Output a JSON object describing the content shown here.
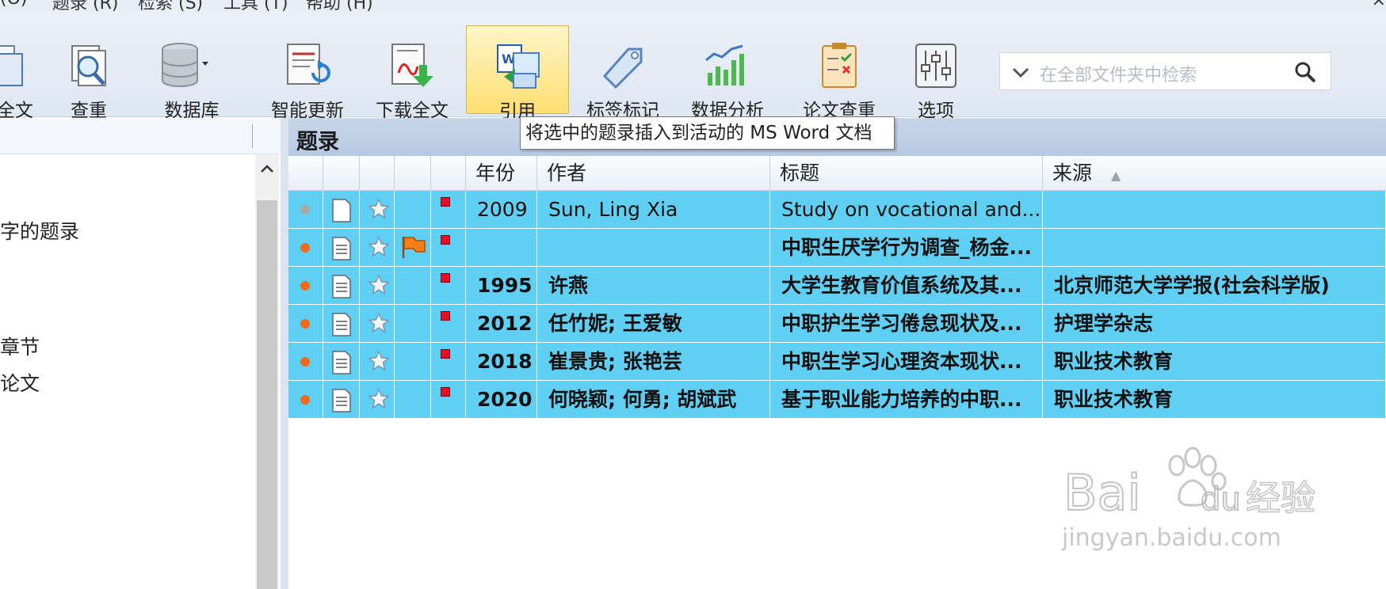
{
  "menubar": {
    "items": [
      "(O)",
      "题录 (R)",
      "检索 (S)",
      "工具 (T)",
      "帮助 (H)"
    ],
    "close_glyph": "×"
  },
  "toolbar": {
    "buttons": [
      {
        "label": "全文",
        "icon": "fulltext-icon"
      },
      {
        "label": "查重",
        "icon": "duplicate-check-icon"
      },
      {
        "label": "数据库",
        "icon": "database-icon"
      },
      {
        "label": "智能更新",
        "icon": "smart-update-icon"
      },
      {
        "label": "下载全文",
        "icon": "download-fulltext-icon"
      },
      {
        "label": "引用",
        "icon": "cite-icon",
        "active": true
      },
      {
        "label": "标签标记",
        "icon": "tag-icon"
      },
      {
        "label": "数据分析",
        "icon": "data-analysis-icon"
      },
      {
        "label": "论文查重",
        "icon": "paper-check-icon"
      },
      {
        "label": "选项",
        "icon": "options-icon"
      }
    ],
    "search_placeholder": "在全部文件夹中检索"
  },
  "left_panel": {
    "items": [
      "字的题录",
      "章节",
      "论文"
    ]
  },
  "main": {
    "title": "题录",
    "columns": [
      "年份",
      "作者",
      "标题",
      "来源"
    ],
    "sort_indicator": "▲",
    "rows": [
      {
        "year": "2009",
        "author": "Sun, Ling Xia",
        "title": "Study on vocational and...",
        "source": "",
        "bold": false,
        "dot_color": "#a9a9a9",
        "doc": "blank",
        "flag": false
      },
      {
        "year": "",
        "author": "",
        "title": "中职生厌学行为调查_杨金...",
        "source": "",
        "bold": true,
        "dot_color": "#f26b1d",
        "doc": "lines",
        "flag": true
      },
      {
        "year": "1995",
        "author": "许燕",
        "title": "大学生教育价值系统及其...",
        "source": "北京师范大学学报(社会科学版)",
        "bold": true,
        "dot_color": "#f26b1d",
        "doc": "lines",
        "flag": false
      },
      {
        "year": "2012",
        "author": "任竹妮; 王爱敏",
        "title": "中职护生学习倦怠现状及...",
        "source": "护理学杂志",
        "bold": true,
        "dot_color": "#f26b1d",
        "doc": "lines",
        "flag": false
      },
      {
        "year": "2018",
        "author": "崔景贵; 张艳芸",
        "title": "中职生学习心理资本现状...",
        "source": "职业技术教育",
        "bold": true,
        "dot_color": "#f26b1d",
        "doc": "lines",
        "flag": false
      },
      {
        "year": "2020",
        "author": "何晓颖; 何勇; 胡斌武",
        "title": "基于职业能力培养的中职...",
        "source": "职业技术教育",
        "bold": true,
        "dot_color": "#f26b1d",
        "doc": "lines",
        "flag": false
      }
    ]
  },
  "tooltip": {
    "text": "将选中的题录插入到活动的 MS Word 文档"
  },
  "watermark": {
    "url": "jingyan.baidu.com"
  }
}
